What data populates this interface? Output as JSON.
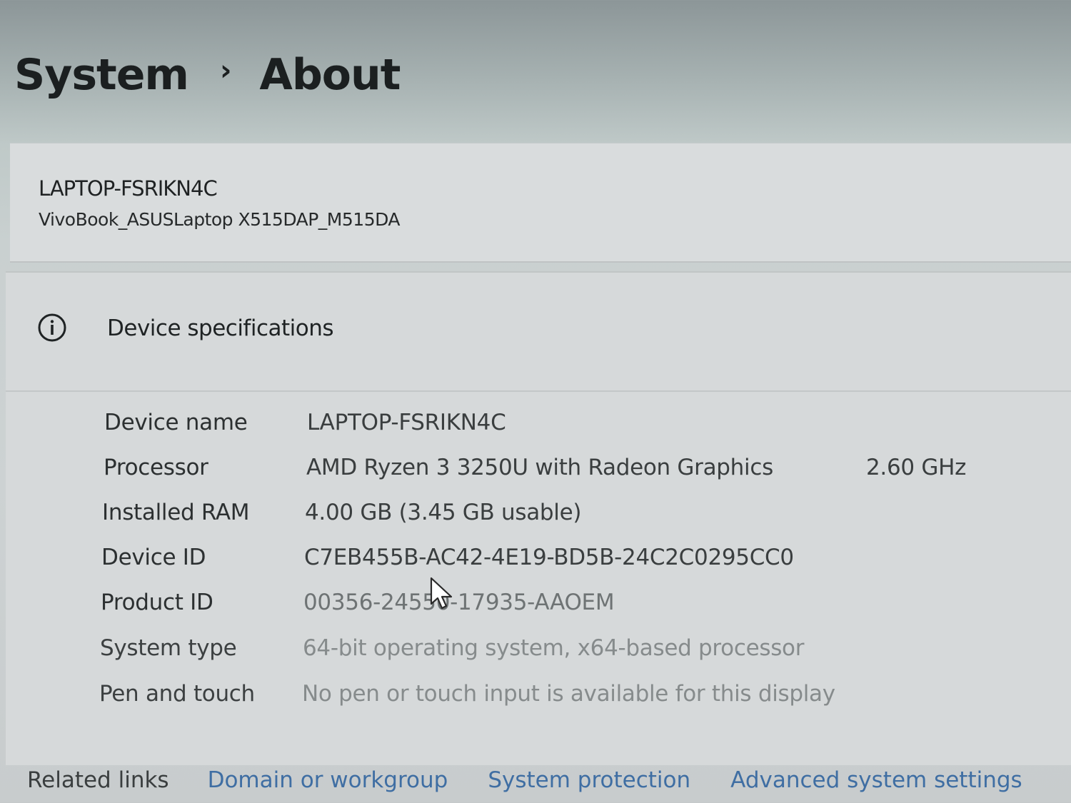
{
  "breadcrumb": {
    "parent": "System",
    "separator": "›",
    "current": "About"
  },
  "device": {
    "name": "LAPTOP-FSRIKN4C",
    "model": "VivoBook_ASUSLaptop X515DAP_M515DA"
  },
  "specs": {
    "title": "Device specifications",
    "icon": "info-icon",
    "rows": [
      {
        "label": "Device name",
        "value": "LAPTOP-FSRIKN4C"
      },
      {
        "label": "Processor",
        "value": "AMD Ryzen 3 3250U with Radeon Graphics",
        "extra": "2.60 GHz"
      },
      {
        "label": "Installed RAM",
        "value": "4.00 GB (3.45 GB usable)"
      },
      {
        "label": "Device ID",
        "value": "C7EB455B-AC42-4E19-BD5B-24C2C0295CC0"
      },
      {
        "label": "Product ID",
        "value": "00356-24550-17935-AAOEM"
      },
      {
        "label": "System type",
        "value": "64-bit operating system, x64-based processor"
      },
      {
        "label": "Pen and touch",
        "value": "No pen or touch input is available for this display"
      }
    ]
  },
  "related": {
    "label": "Related links",
    "links": [
      "Domain or workgroup",
      "System protection",
      "Advanced system settings"
    ]
  },
  "colors": {
    "link": "#3f6ea3",
    "card": "#d6d9da"
  }
}
